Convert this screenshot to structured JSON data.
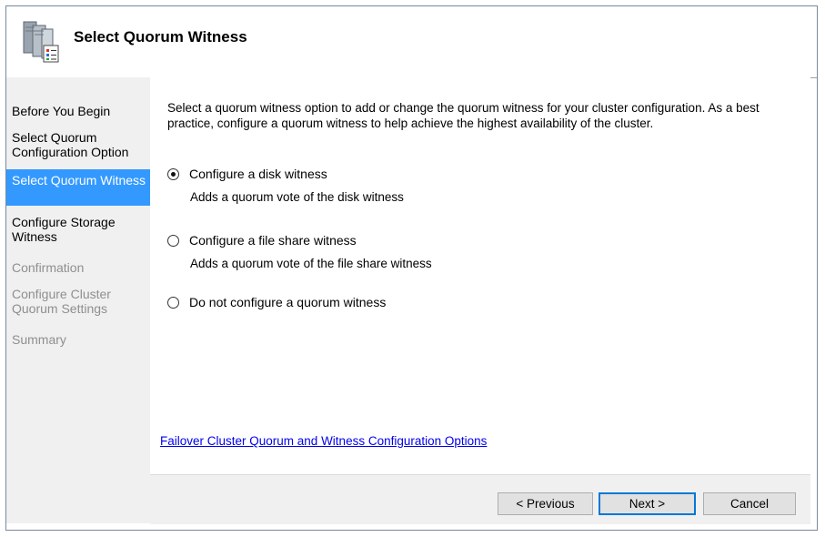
{
  "header": {
    "title": "Select Quorum Witness",
    "icon": "cluster-server-icon"
  },
  "sidebar": {
    "items": [
      {
        "label": "Before You Begin",
        "state": "normal"
      },
      {
        "label": "Select Quorum Configuration Option",
        "state": "normal"
      },
      {
        "label": "Select Quorum Witness",
        "state": "active"
      },
      {
        "label": "Configure Storage Witness",
        "state": "normal"
      },
      {
        "label": "Confirmation",
        "state": "disabled"
      },
      {
        "label": "Configure Cluster Quorum Settings",
        "state": "disabled"
      },
      {
        "label": "Summary",
        "state": "disabled"
      }
    ]
  },
  "main": {
    "intro": "Select a quorum witness option to add or change the quorum witness for your cluster configuration. As a best practice, configure a quorum witness to help achieve the highest availability of the cluster.",
    "options": [
      {
        "label": "Configure a disk witness",
        "description": "Adds a quorum vote of the disk witness",
        "selected": true
      },
      {
        "label": "Configure a file share witness",
        "description": "Adds a quorum vote of the file share witness",
        "selected": false
      },
      {
        "label": "Do not configure a quorum witness",
        "description": "",
        "selected": false
      }
    ],
    "help_link": "Failover Cluster Quorum and Witness Configuration Options"
  },
  "footer": {
    "previous_label": "< Previous",
    "next_label": "Next >",
    "cancel_label": "Cancel"
  },
  "colors": {
    "active_item_bg": "#3399ff",
    "link": "#0000ee",
    "panel_bg": "#f0f0f0"
  }
}
